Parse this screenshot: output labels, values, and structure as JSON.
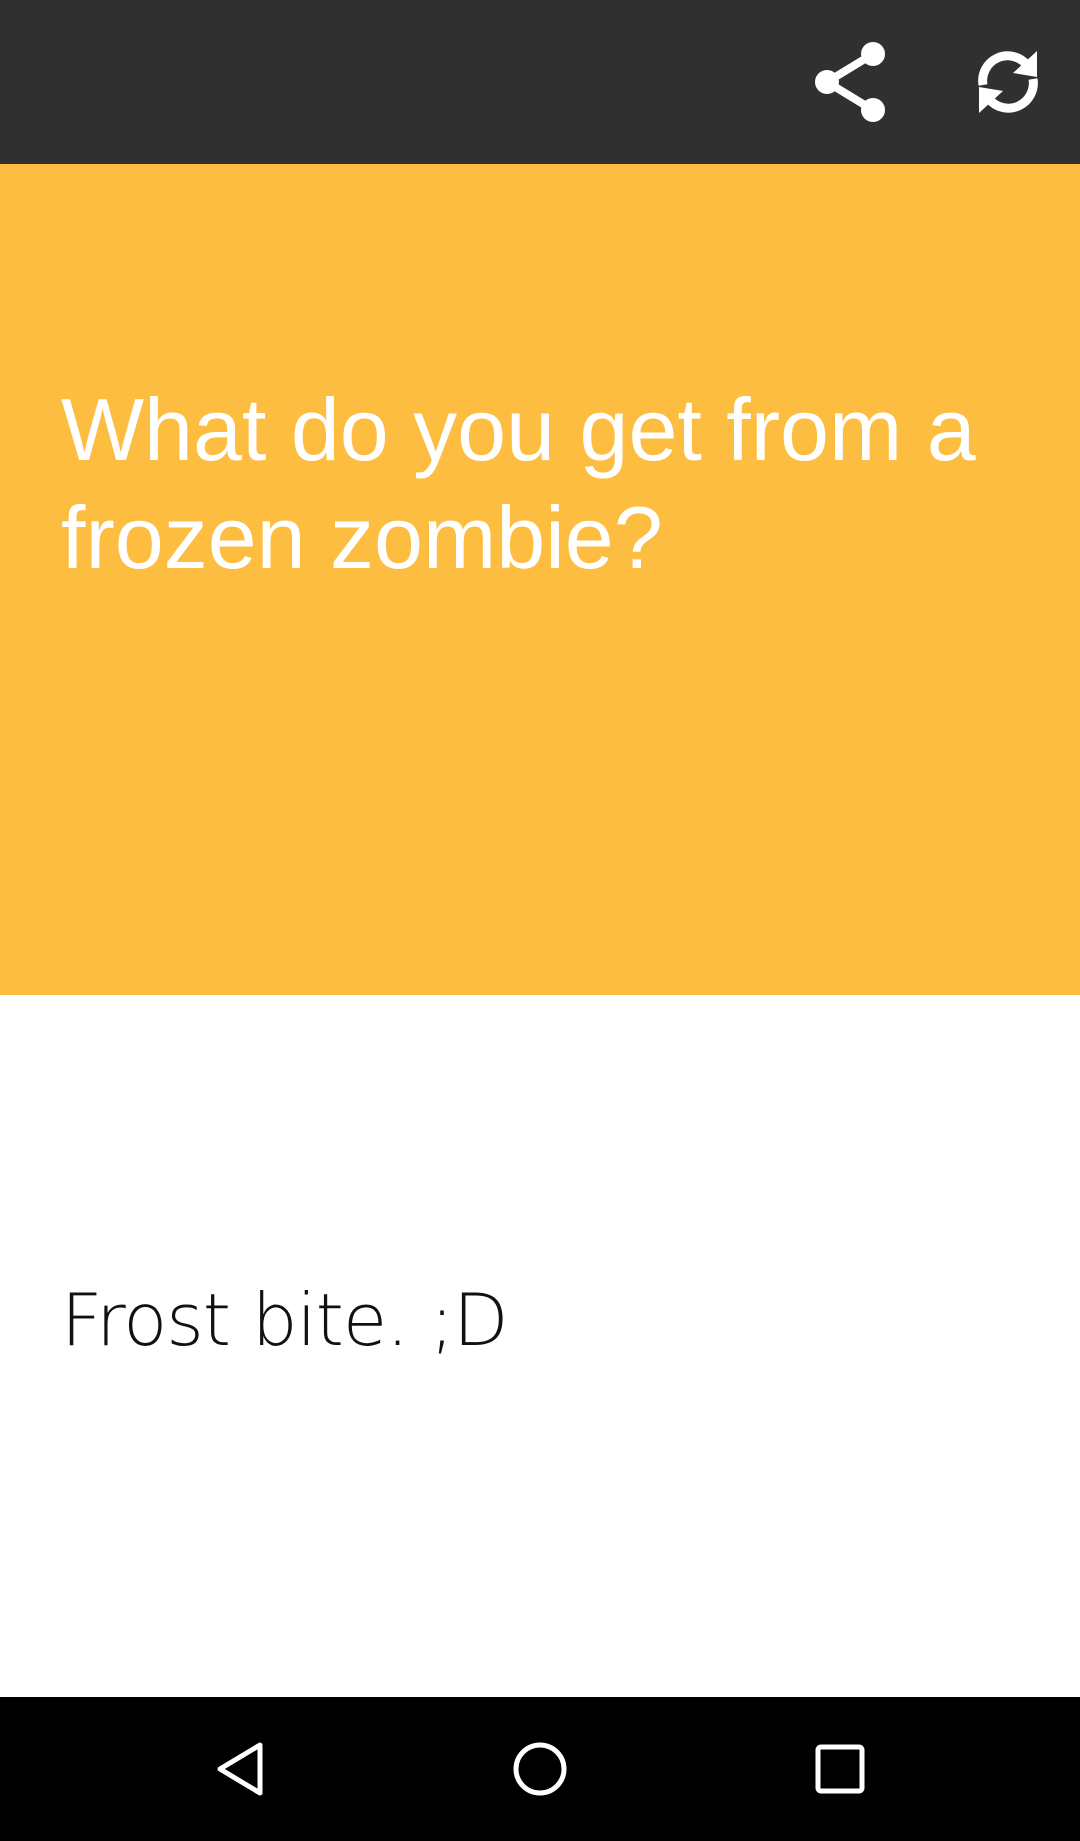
{
  "toolbar": {
    "share_icon": "share-icon",
    "refresh_icon": "refresh-icon",
    "background_color": "#303030"
  },
  "question": {
    "text": "What do you get from a frozen zombie?",
    "background_color": "#fdbd40"
  },
  "answer": {
    "text": "Frost bite. ;D"
  },
  "navbar": {
    "back_icon": "back-triangle-icon",
    "home_icon": "home-circle-icon",
    "recents_icon": "recents-square-icon"
  }
}
